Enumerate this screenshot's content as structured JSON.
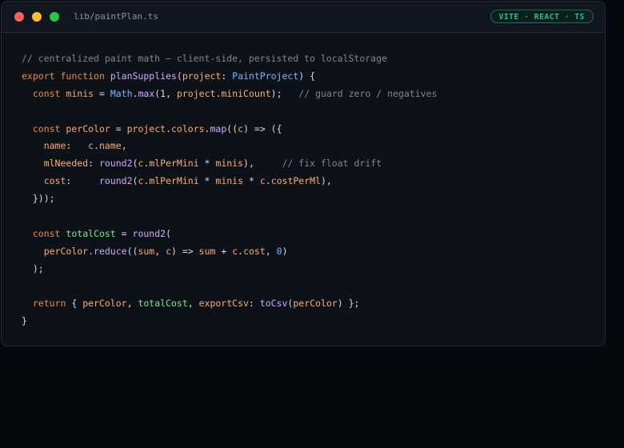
{
  "window": {
    "filename": "lib/paintPlan.ts",
    "badge": "VITE · REACT · TS"
  },
  "code_lines": [
    [
      {
        "t": "// centralized paint math — client-side, persisted to localStorage",
        "c": "comment"
      }
    ],
    [
      {
        "t": "export",
        "c": "kw"
      },
      {
        "t": " ",
        "c": "plain"
      },
      {
        "t": "function",
        "c": "kw"
      },
      {
        "t": " ",
        "c": "plain"
      },
      {
        "t": "planSupplies",
        "c": "fn"
      },
      {
        "t": "(",
        "c": "plain"
      },
      {
        "t": "project",
        "c": "param"
      },
      {
        "t": ": ",
        "c": "plain"
      },
      {
        "t": "PaintProject",
        "c": "type"
      },
      {
        "t": ") {",
        "c": "plain"
      }
    ],
    [
      {
        "t": "  ",
        "c": "plain"
      },
      {
        "t": "const",
        "c": "kw"
      },
      {
        "t": " ",
        "c": "plain"
      },
      {
        "t": "minis",
        "c": "var"
      },
      {
        "t": " = ",
        "c": "plain"
      },
      {
        "t": "Math",
        "c": "type"
      },
      {
        "t": ".",
        "c": "plain"
      },
      {
        "t": "max",
        "c": "fn"
      },
      {
        "t": "(1, ",
        "c": "plain"
      },
      {
        "t": "project",
        "c": "param"
      },
      {
        "t": ".",
        "c": "plain"
      },
      {
        "t": "miniCount",
        "c": "prop"
      },
      {
        "t": ");   ",
        "c": "plain"
      },
      {
        "t": "// guard zero / negatives",
        "c": "comment"
      }
    ],
    [],
    [
      {
        "t": "  ",
        "c": "plain"
      },
      {
        "t": "const",
        "c": "kw"
      },
      {
        "t": " ",
        "c": "plain"
      },
      {
        "t": "perColor",
        "c": "var"
      },
      {
        "t": " = ",
        "c": "plain"
      },
      {
        "t": "project",
        "c": "param"
      },
      {
        "t": ".",
        "c": "plain"
      },
      {
        "t": "colors",
        "c": "prop"
      },
      {
        "t": ".",
        "c": "plain"
      },
      {
        "t": "map",
        "c": "fn"
      },
      {
        "t": "((",
        "c": "plain"
      },
      {
        "t": "c",
        "c": "param"
      },
      {
        "t": ") => ({",
        "c": "plain"
      }
    ],
    [
      {
        "t": "    ",
        "c": "plain"
      },
      {
        "t": "name",
        "c": "prop"
      },
      {
        "t": ":   ",
        "c": "plain"
      },
      {
        "t": "c",
        "c": "param"
      },
      {
        "t": ".",
        "c": "plain"
      },
      {
        "t": "name",
        "c": "prop"
      },
      {
        "t": ",",
        "c": "plain"
      }
    ],
    [
      {
        "t": "    ",
        "c": "plain"
      },
      {
        "t": "mlNeeded",
        "c": "prop"
      },
      {
        "t": ": ",
        "c": "plain"
      },
      {
        "t": "round2",
        "c": "fn"
      },
      {
        "t": "(",
        "c": "plain"
      },
      {
        "t": "c",
        "c": "param"
      },
      {
        "t": ".",
        "c": "plain"
      },
      {
        "t": "mlPerMini",
        "c": "prop"
      },
      {
        "t": " * ",
        "c": "plain"
      },
      {
        "t": "minis",
        "c": "var"
      },
      {
        "t": "),     ",
        "c": "plain"
      },
      {
        "t": "// fix float drift",
        "c": "comment"
      }
    ],
    [
      {
        "t": "    ",
        "c": "plain"
      },
      {
        "t": "cost",
        "c": "prop"
      },
      {
        "t": ":     ",
        "c": "plain"
      },
      {
        "t": "round2",
        "c": "fn"
      },
      {
        "t": "(",
        "c": "plain"
      },
      {
        "t": "c",
        "c": "param"
      },
      {
        "t": ".",
        "c": "plain"
      },
      {
        "t": "mlPerMini",
        "c": "prop"
      },
      {
        "t": " * ",
        "c": "plain"
      },
      {
        "t": "minis",
        "c": "var"
      },
      {
        "t": " * ",
        "c": "plain"
      },
      {
        "t": "c",
        "c": "param"
      },
      {
        "t": ".",
        "c": "plain"
      },
      {
        "t": "costPerMl",
        "c": "prop"
      },
      {
        "t": "),",
        "c": "plain"
      }
    ],
    [
      {
        "t": "  }));",
        "c": "plain"
      }
    ],
    [],
    [
      {
        "t": "  ",
        "c": "plain"
      },
      {
        "t": "const",
        "c": "kw"
      },
      {
        "t": " ",
        "c": "plain"
      },
      {
        "t": "totalCost",
        "c": "green"
      },
      {
        "t": " = ",
        "c": "plain"
      },
      {
        "t": "round2",
        "c": "fn"
      },
      {
        "t": "(",
        "c": "plain"
      }
    ],
    [
      {
        "t": "    ",
        "c": "plain"
      },
      {
        "t": "perColor",
        "c": "var"
      },
      {
        "t": ".",
        "c": "plain"
      },
      {
        "t": "reduce",
        "c": "fn"
      },
      {
        "t": "((",
        "c": "plain"
      },
      {
        "t": "sum",
        "c": "param"
      },
      {
        "t": ", ",
        "c": "plain"
      },
      {
        "t": "c",
        "c": "param"
      },
      {
        "t": ") => ",
        "c": "plain"
      },
      {
        "t": "sum",
        "c": "param"
      },
      {
        "t": " + ",
        "c": "plain"
      },
      {
        "t": "c",
        "c": "param"
      },
      {
        "t": ".",
        "c": "plain"
      },
      {
        "t": "cost",
        "c": "prop"
      },
      {
        "t": ", ",
        "c": "plain"
      },
      {
        "t": "0",
        "c": "num"
      },
      {
        "t": ")",
        "c": "plain"
      }
    ],
    [
      {
        "t": "  );",
        "c": "plain"
      }
    ],
    [],
    [
      {
        "t": "  ",
        "c": "plain"
      },
      {
        "t": "return",
        "c": "kw"
      },
      {
        "t": " { ",
        "c": "plain"
      },
      {
        "t": "perColor",
        "c": "var"
      },
      {
        "t": ", ",
        "c": "plain"
      },
      {
        "t": "totalCost",
        "c": "green"
      },
      {
        "t": ", ",
        "c": "plain"
      },
      {
        "t": "exportCsv",
        "c": "var"
      },
      {
        "t": ": ",
        "c": "plain"
      },
      {
        "t": "toCsv",
        "c": "fn"
      },
      {
        "t": "(",
        "c": "plain"
      },
      {
        "t": "perColor",
        "c": "var"
      },
      {
        "t": ") };",
        "c": "plain"
      }
    ],
    [
      {
        "t": "}",
        "c": "plain"
      }
    ]
  ]
}
